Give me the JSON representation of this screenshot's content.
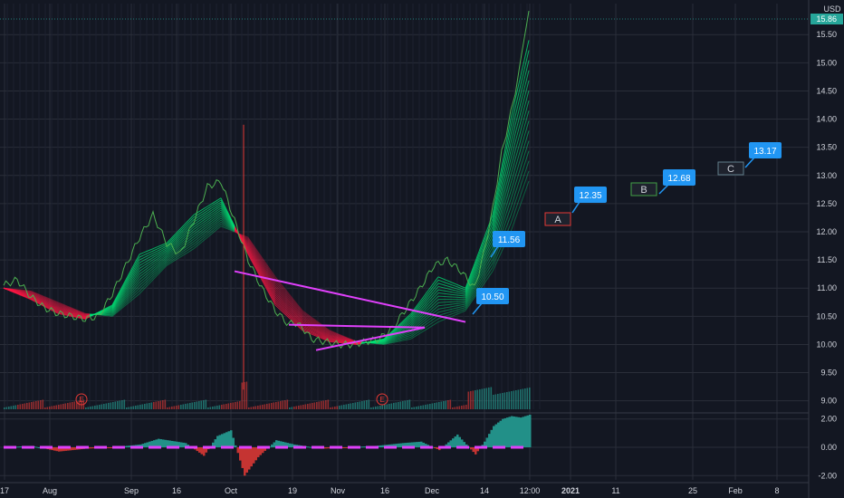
{
  "chart_data": {
    "type": "line",
    "title": "",
    "currency": "USD",
    "last_price": "15.86",
    "price_axis": {
      "ticks": [
        "15.50",
        "15.00",
        "14.50",
        "14.00",
        "13.50",
        "13.00",
        "12.50",
        "12.00",
        "11.50",
        "11.00",
        "10.50",
        "10.00",
        "9.50",
        "9.00"
      ],
      "ylim": [
        8.85,
        16.05
      ]
    },
    "time_axis": {
      "ticks": [
        "17",
        "Aug",
        "Sep",
        "16",
        "Oct",
        "19",
        "Nov",
        "16",
        "Dec",
        "14",
        "12:00",
        "2021",
        "11",
        "25",
        "Feb",
        "8"
      ],
      "bold": [
        "2021"
      ]
    },
    "oscillator_axis": {
      "ticks": [
        "2.00",
        "0.00",
        "-2.00"
      ],
      "ylim": [
        -2.3,
        2.3
      ]
    },
    "earnings_markers": [
      "E",
      "E"
    ],
    "price_labels": [
      {
        "text": "11.56",
        "value": 11.56
      },
      {
        "text": "10.50",
        "value": 10.5
      },
      {
        "text": "12.35",
        "value": 12.35
      },
      {
        "text": "12.68",
        "value": 12.68
      },
      {
        "text": "13.17",
        "value": 13.17
      }
    ],
    "wave_labels": [
      {
        "text": "A",
        "value": 12.25,
        "color": "#e53935"
      },
      {
        "text": "B",
        "value": 12.8,
        "color": "#43a047"
      },
      {
        "text": "C",
        "value": 13.1,
        "color": "#607d8b"
      }
    ],
    "series": [
      {
        "role": "price",
        "color": "#26a69a",
        "x": [
          0,
          3,
          6,
          9,
          12,
          15,
          18,
          21,
          24,
          27,
          30,
          33,
          36,
          39,
          42,
          45,
          48,
          51,
          54,
          57,
          60,
          63,
          64,
          66,
          68,
          71,
          74,
          77,
          80,
          83,
          86,
          89,
          92,
          95,
          98,
          101,
          104,
          106,
          108,
          110,
          112,
          114,
          115,
          116
        ],
        "y": [
          11.05,
          11.15,
          10.85,
          10.65,
          10.55,
          10.5,
          10.45,
          10.5,
          10.9,
          11.4,
          11.9,
          12.3,
          11.8,
          11.6,
          12.2,
          12.8,
          12.9,
          12.2,
          11.5,
          11.0,
          10.6,
          10.35,
          10.4,
          10.3,
          10.1,
          10.05,
          10.0,
          10.0,
          10.05,
          10.1,
          10.3,
          10.65,
          11.0,
          11.4,
          11.5,
          11.3,
          11.0,
          11.6,
          12.4,
          13.4,
          14.1,
          14.9,
          15.5,
          15.86
        ]
      },
      {
        "role": "ribbon-fast",
        "colors": [
          "#00e676",
          "#ff1744"
        ],
        "x": [
          0,
          6,
          12,
          18,
          24,
          30,
          36,
          42,
          48,
          54,
          60,
          66,
          72,
          78,
          84,
          90,
          96,
          102,
          108,
          112,
          116
        ],
        "y": [
          11.0,
          10.8,
          10.55,
          10.45,
          10.7,
          11.6,
          11.8,
          12.3,
          12.6,
          11.6,
          10.7,
          10.25,
          10.05,
          10.0,
          10.1,
          10.55,
          11.2,
          11.0,
          12.3,
          14.0,
          15.4
        ]
      },
      {
        "role": "ribbon-slow",
        "colors": [
          "#00e676",
          "#ff1744"
        ],
        "x": [
          0,
          6,
          12,
          18,
          24,
          30,
          36,
          42,
          48,
          54,
          60,
          66,
          72,
          78,
          84,
          90,
          96,
          102,
          108,
          112,
          116
        ],
        "y": [
          11.0,
          10.95,
          10.75,
          10.55,
          10.5,
          10.9,
          11.4,
          11.7,
          12.1,
          11.9,
          11.2,
          10.6,
          10.25,
          10.05,
          10.0,
          10.1,
          10.4,
          10.6,
          11.3,
          12.0,
          12.9
        ]
      }
    ],
    "trendlines": [
      {
        "color": "#e040fb",
        "points": [
          [
            51,
            11.3
          ],
          [
            102,
            10.4
          ]
        ]
      },
      {
        "color": "#e040fb",
        "points": [
          [
            63,
            10.35
          ],
          [
            93,
            10.3
          ]
        ]
      },
      {
        "color": "#e040fb",
        "points": [
          [
            69,
            9.9
          ],
          [
            93,
            10.3
          ]
        ]
      }
    ],
    "oscillator": {
      "x": [
        0,
        6,
        12,
        18,
        24,
        30,
        34,
        40,
        44,
        47,
        50,
        53,
        56,
        60,
        64,
        70,
        76,
        82,
        88,
        92,
        96,
        100,
        104,
        106,
        108,
        110,
        112,
        114,
        116
      ],
      "y": [
        0.0,
        0.1,
        -0.3,
        -0.1,
        0.0,
        0.2,
        0.6,
        0.3,
        -0.6,
        0.8,
        1.2,
        -2.0,
        -0.7,
        0.5,
        0.2,
        -0.1,
        0.0,
        0.1,
        0.3,
        0.4,
        -0.2,
        0.9,
        -0.5,
        0.4,
        1.5,
        2.0,
        2.2,
        2.1,
        2.3
      ],
      "pos_color": "#26a69a",
      "neg_color": "#e53935",
      "zero_color": "#e040fb"
    },
    "grid": true,
    "legend": "none"
  },
  "colors": {
    "background": "#131722",
    "grid": "#2a2e39",
    "axis_text": "#d1d4dc",
    "label_fill": "#2196f3"
  }
}
